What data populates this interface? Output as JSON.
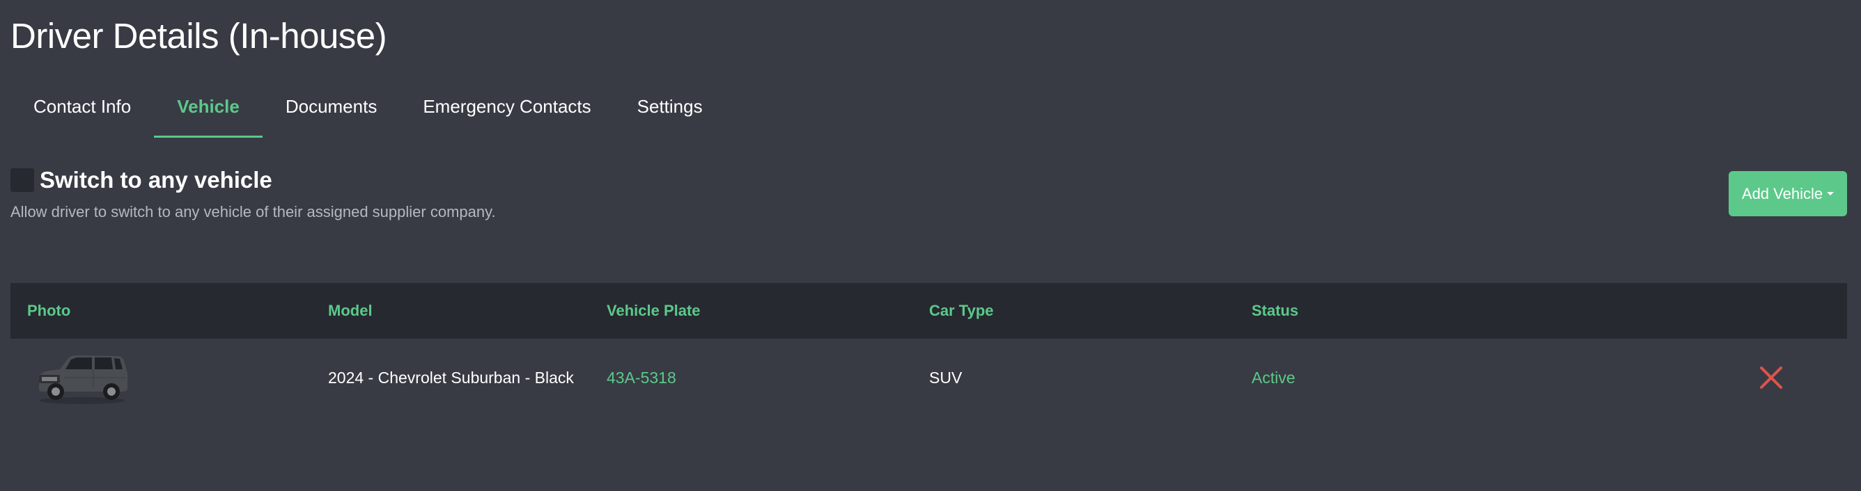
{
  "page": {
    "title": "Driver Details (In-house)"
  },
  "tabs": [
    {
      "label": "Contact Info",
      "active": false
    },
    {
      "label": "Vehicle",
      "active": true
    },
    {
      "label": "Documents",
      "active": false
    },
    {
      "label": "Emergency Contacts",
      "active": false
    },
    {
      "label": "Settings",
      "active": false
    }
  ],
  "switch_vehicle": {
    "label": "Switch to any vehicle",
    "description": "Allow driver to switch to any vehicle of their assigned supplier company.",
    "checked": false
  },
  "add_vehicle": {
    "label": "Add Vehicle"
  },
  "table": {
    "columns": [
      "Photo",
      "Model",
      "Vehicle Plate",
      "Car Type",
      "Status"
    ],
    "rows": [
      {
        "photo_icon": "suv-car-photo",
        "model": "2024 - Chevrolet Suburban - Black",
        "plate": "43A-5318",
        "car_type": "SUV",
        "status": "Active",
        "delete_icon": "close-icon"
      }
    ]
  },
  "colors": {
    "background": "#383b44",
    "header_bg": "#262930",
    "accent": "#5cc98a",
    "danger": "#e0534a",
    "muted_text": "#b5b8bf"
  }
}
